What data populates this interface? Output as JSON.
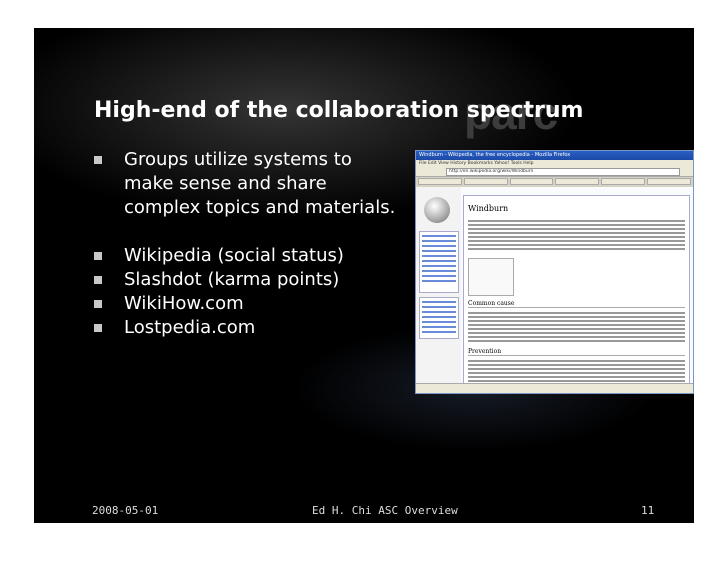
{
  "slide": {
    "watermark": "parc",
    "title": "High-end of the collaboration spectrum",
    "bullets": [
      "Groups utilize systems to make sense and share complex topics and materials.",
      "Wikipedia (social status)",
      "Slashdot (karma points)",
      "WikiHow.com",
      "Lostpedia.com"
    ],
    "footer": {
      "date": "2008-05-01",
      "center": "Ed H. Chi  ASC Overview",
      "page": "11"
    }
  },
  "screenshot": {
    "window_title": "Windburn - Wikipedia, the free encyclopedia - Mozilla Firefox",
    "menu": "File  Edit  View  History  Bookmarks  Yahoo!  Tools  Help",
    "url": "http://en.wikipedia.org/wiki/Windburn",
    "article_title": "Windburn",
    "sections": [
      "Common cause",
      "Prevention"
    ]
  },
  "colors": {
    "slide_background": "#000000",
    "bullet_square": "#c8c8c8",
    "titlebar": "#2a5fc2"
  }
}
